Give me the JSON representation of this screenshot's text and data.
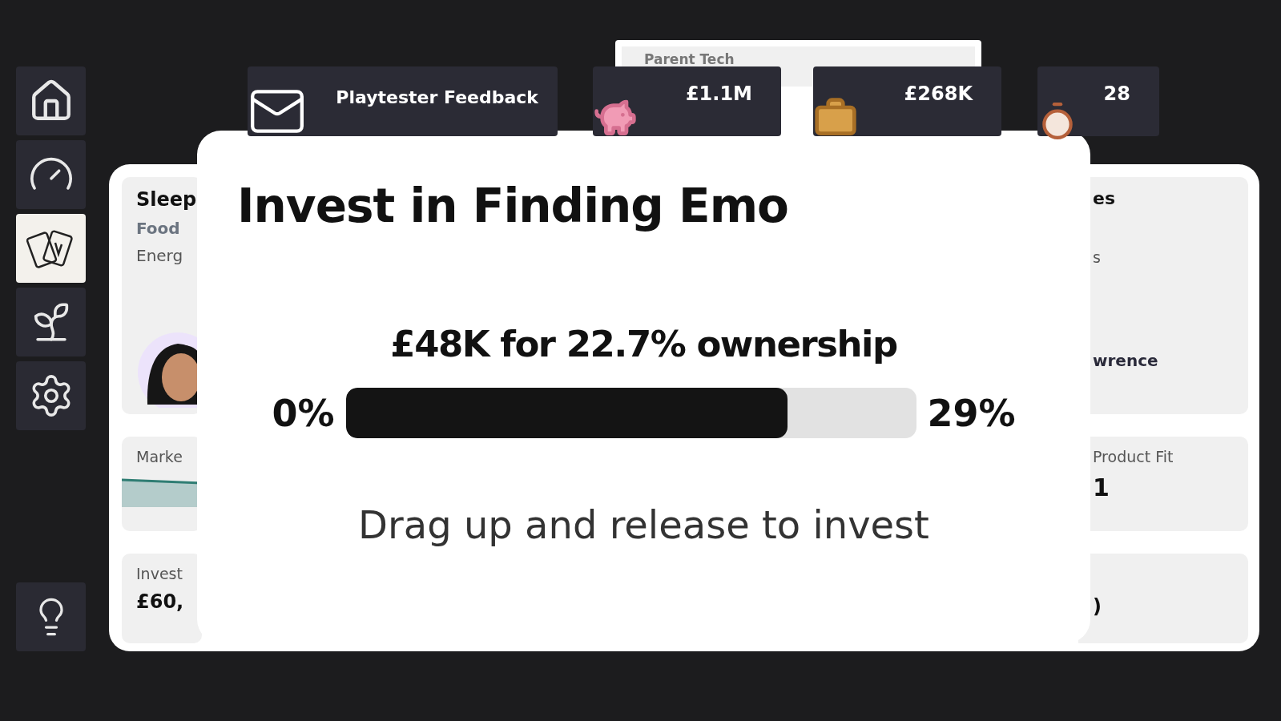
{
  "sidebar": {
    "items": [
      {
        "kind": "home",
        "selected": false
      },
      {
        "kind": "gauge",
        "selected": false
      },
      {
        "kind": "cards",
        "selected": true
      },
      {
        "kind": "plant",
        "selected": false
      },
      {
        "kind": "settings",
        "selected": false
      }
    ],
    "help": {
      "kind": "bulb"
    }
  },
  "background_card": {
    "title": "Parent Tech"
  },
  "top_bar": {
    "feedback_button": "Playtester Feedback",
    "stats": [
      {
        "kind": "money",
        "value": "£1.1M"
      },
      {
        "kind": "valuation",
        "value": "£268K"
      },
      {
        "kind": "time",
        "value": "28"
      }
    ]
  },
  "company_panel": {
    "left": {
      "name": "Sleep",
      "category": "Food",
      "energy": "Energ",
      "market_label": "Marke",
      "invest_label": "Invest",
      "invest_value": "£60,"
    },
    "right": {
      "heading": "es",
      "line_2": "s",
      "founder": "wrence",
      "fit_label": "Product Fit",
      "fit_value": "1",
      "bottom_value": ")"
    }
  },
  "modal": {
    "title": "Invest in Finding Emo",
    "offer": "£48K for 22.7% ownership",
    "slider": {
      "level": 0.775,
      "min_label": "0%",
      "max_label": "29%"
    },
    "hint": "Drag up and release to invest"
  }
}
